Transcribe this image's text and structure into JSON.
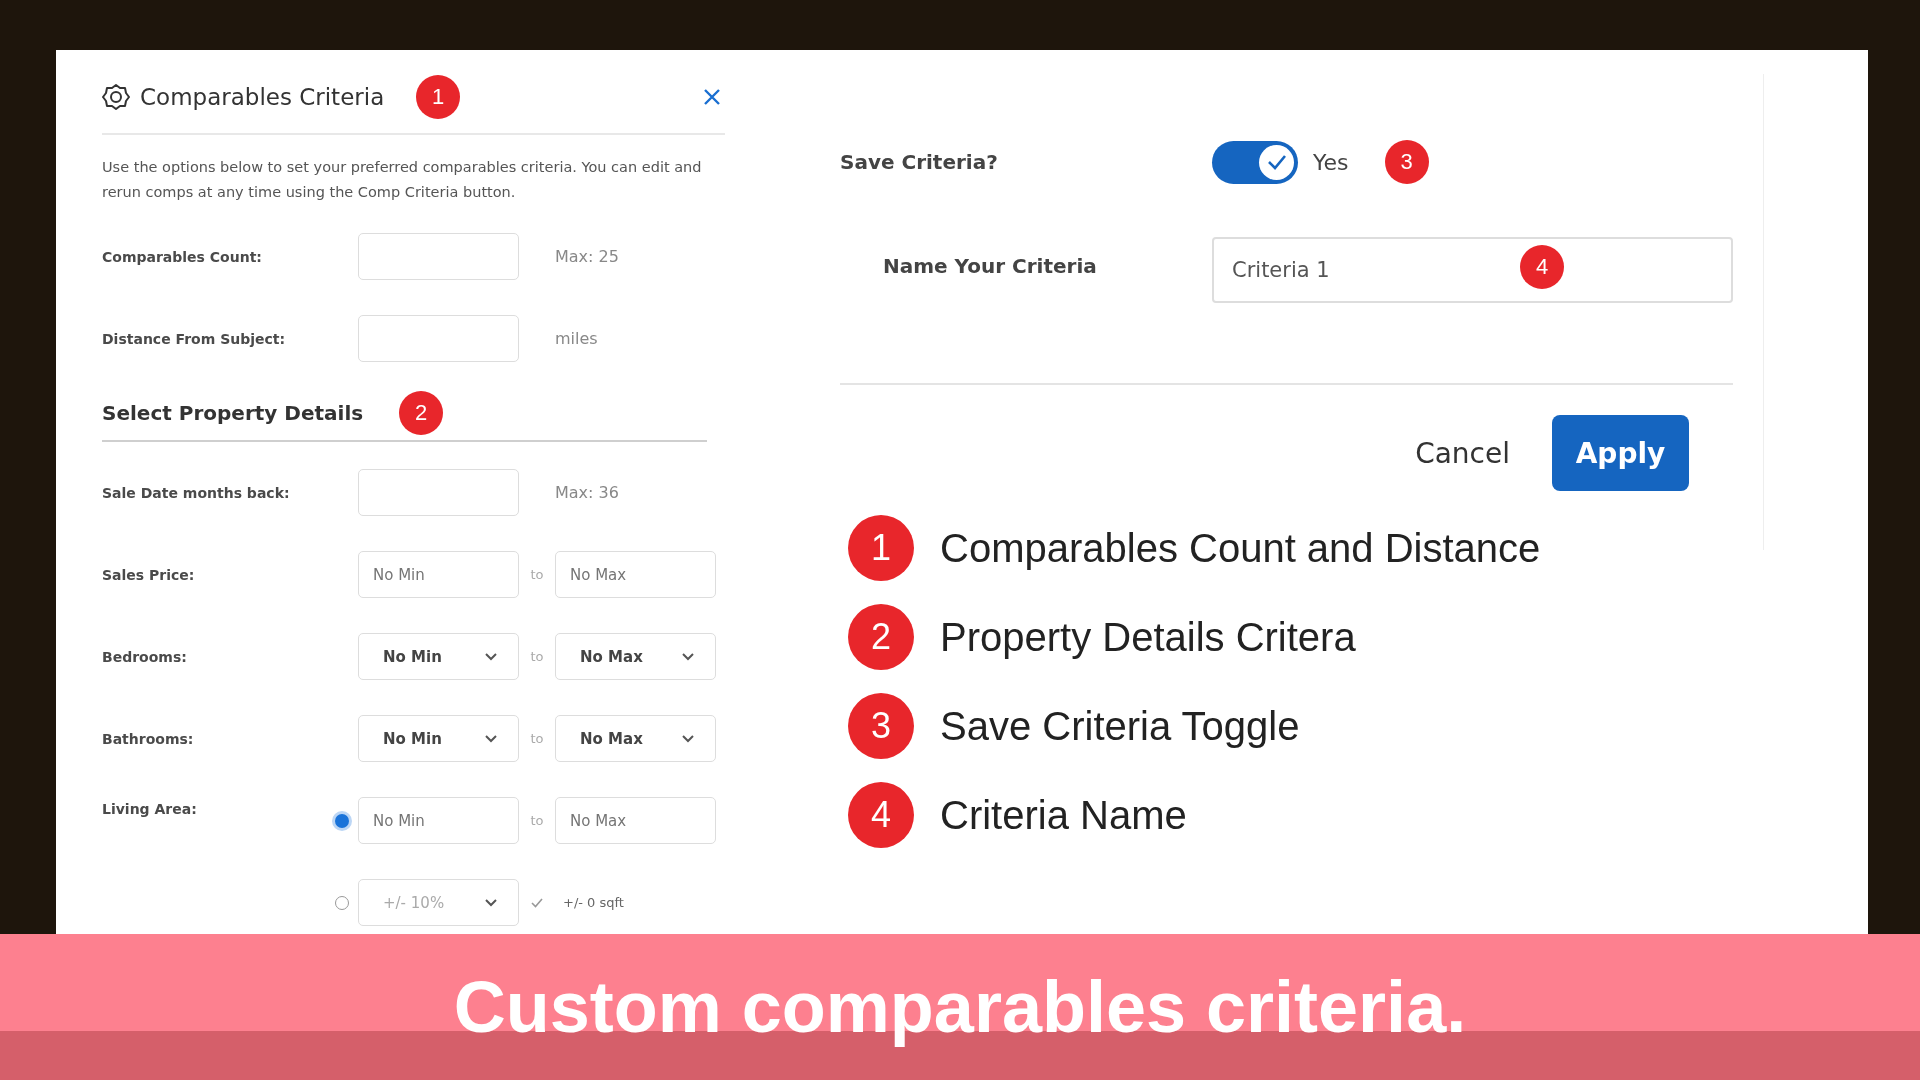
{
  "panel": {
    "title": "Comparables Criteria",
    "title_badge": "1",
    "description": "Use the options below to set your preferred comparables criteria. You can edit and rerun comps at any time using the Comp Criteria button.",
    "fields": [
      {
        "kind": "single",
        "label": "Comparables Count:",
        "note": "Max: 25"
      },
      {
        "kind": "single",
        "label": "Distance From Subject:",
        "note": "miles"
      }
    ],
    "section_title": "Select Property Details",
    "section_badge": "2",
    "detail_rows": [
      {
        "kind": "single",
        "label": "Sale Date months back:",
        "note": "Max: 36"
      },
      {
        "kind": "range_input",
        "label": "Sales Price:",
        "min_placeholder": "No Min",
        "connector": "to",
        "max_placeholder": "No Max"
      },
      {
        "kind": "range_select",
        "label": "Bedrooms:",
        "min": "No Min",
        "connector": "to",
        "max": "No Max"
      },
      {
        "kind": "range_select",
        "label": "Bathrooms:",
        "min": "No Min",
        "connector": "to",
        "max": "No Max"
      },
      {
        "kind": "radio_group",
        "label": "Living Area:",
        "options": [
          {
            "kind": "range_input",
            "selected": true,
            "min_placeholder": "No Min",
            "connector": "to",
            "max_placeholder": "No Max"
          },
          {
            "kind": "percent_select",
            "selected": false,
            "value": "+/- 10%",
            "result": "+/- 0 sqft"
          }
        ]
      }
    ]
  },
  "save": {
    "label": "Save Criteria?",
    "on": true,
    "state_label": "Yes",
    "badge": "3",
    "name_label": "Name Your Criteria",
    "name_value": "Criteria 1",
    "name_badge": "4",
    "cancel": "Cancel",
    "apply": "Apply"
  },
  "legend": [
    {
      "number": "1",
      "text": "Comparables Count and Distance"
    },
    {
      "number": "2",
      "text": "Property Details Critera"
    },
    {
      "number": "3",
      "text": "Save Criteria Toggle"
    },
    {
      "number": "4",
      "text": "Criteria Name"
    }
  ],
  "caption": "Custom comparables criteria."
}
